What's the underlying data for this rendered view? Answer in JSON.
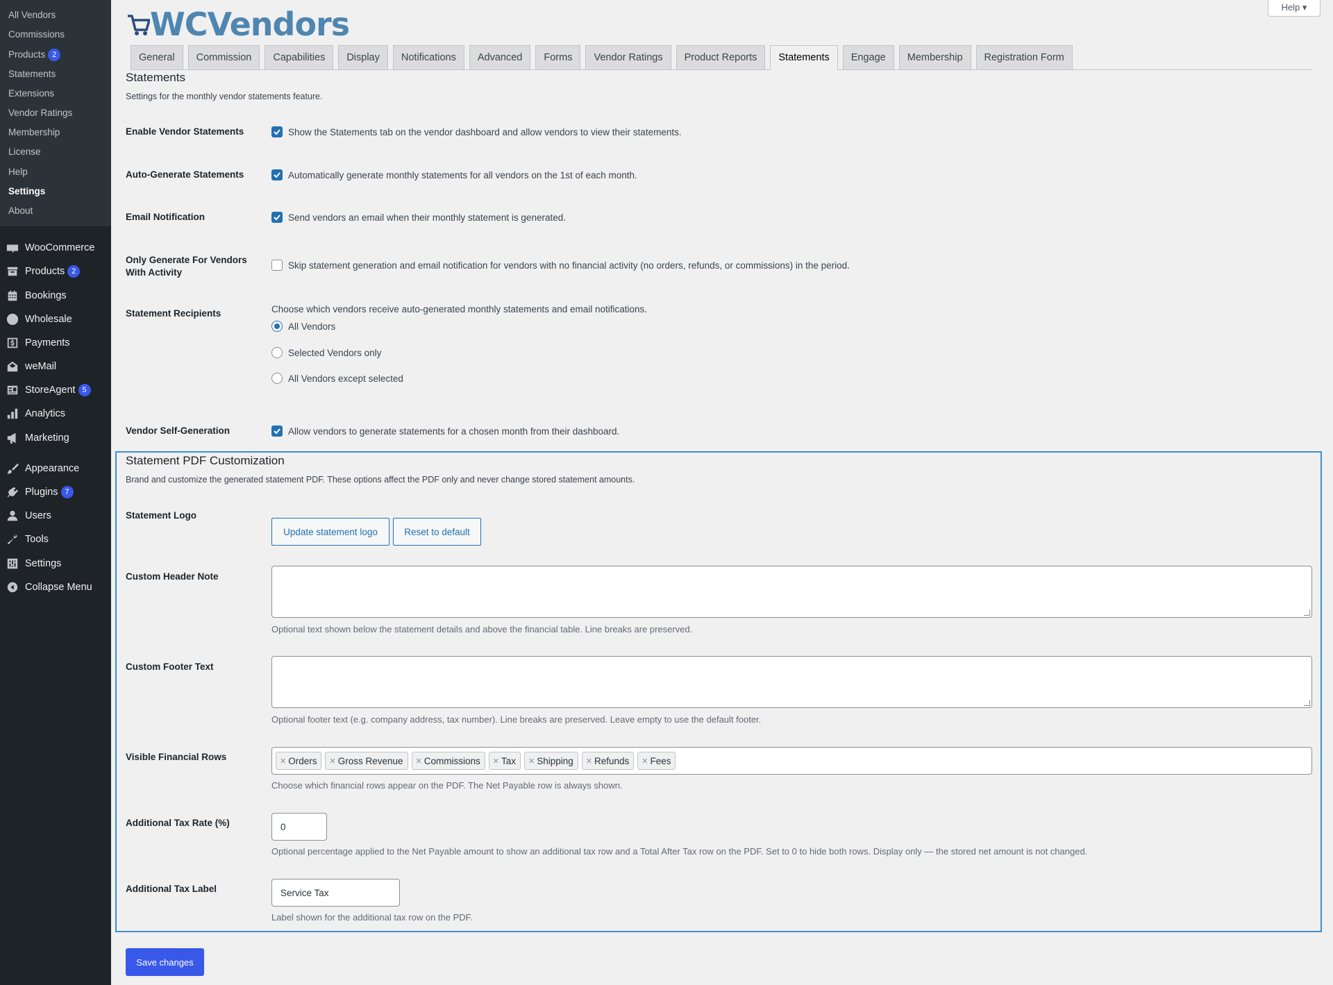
{
  "sidebar": {
    "sub_items": [
      {
        "label": "All Vendors",
        "badge": ""
      },
      {
        "label": "Commissions",
        "badge": ""
      },
      {
        "label": "Products",
        "badge": "2"
      },
      {
        "label": "Statements",
        "badge": ""
      },
      {
        "label": "Extensions",
        "badge": ""
      },
      {
        "label": "Vendor Ratings",
        "badge": ""
      },
      {
        "label": "Membership",
        "badge": ""
      },
      {
        "label": "License",
        "badge": ""
      },
      {
        "label": "Help",
        "badge": ""
      },
      {
        "label": "Settings",
        "badge": ""
      },
      {
        "label": "About",
        "badge": ""
      }
    ],
    "menu_items": [
      {
        "label": "WooCommerce",
        "icon": "woocommerce-icon",
        "badge": ""
      },
      {
        "label": "Products",
        "icon": "archive-icon",
        "badge": "2"
      },
      {
        "label": "Bookings",
        "icon": "calendar-icon",
        "badge": ""
      },
      {
        "label": "Wholesale",
        "icon": "wholesale-icon",
        "badge": ""
      },
      {
        "label": "Payments",
        "icon": "dollar-icon",
        "badge": ""
      },
      {
        "label": "weMail",
        "icon": "mail-icon",
        "badge": ""
      },
      {
        "label": "StoreAgent",
        "icon": "list-icon",
        "badge": "5"
      },
      {
        "label": "Analytics",
        "icon": "chart-bar-icon",
        "badge": ""
      },
      {
        "label": "Marketing",
        "icon": "megaphone-icon",
        "badge": ""
      },
      {
        "label": "Appearance",
        "icon": "paintbrush-icon",
        "badge": ""
      },
      {
        "label": "Plugins",
        "icon": "plugin-icon",
        "badge": "7"
      },
      {
        "label": "Users",
        "icon": "user-icon",
        "badge": ""
      },
      {
        "label": "Tools",
        "icon": "wrench-icon",
        "badge": ""
      },
      {
        "label": "Settings",
        "icon": "settings-icon",
        "badge": ""
      },
      {
        "label": "Collapse Menu",
        "icon": "collapse-icon",
        "badge": ""
      }
    ]
  },
  "header": {
    "logo_text": "WCVendors",
    "help_label": "Help ▾"
  },
  "tabs": [
    "General",
    "Commission",
    "Capabilities",
    "Display",
    "Notifications",
    "Advanced",
    "Forms",
    "Vendor Ratings",
    "Product Reports",
    "Statements",
    "Engage",
    "Membership",
    "Registration Form"
  ],
  "statements": {
    "title": "Statements",
    "description": "Settings for the monthly vendor statements feature.",
    "enable_label": "Enable Vendor Statements",
    "enable_text": "Show the Statements tab on the vendor dashboard and allow vendors to view their statements.",
    "auto_label": "Auto-Generate Statements",
    "auto_text": "Automatically generate monthly statements for all vendors on the 1st of each month.",
    "email_label": "Email Notification",
    "email_text": "Send vendors an email when their monthly statement is generated.",
    "activity_label": "Only Generate For Vendors With Activity",
    "activity_text": "Skip statement generation and email notification for vendors with no financial activity (no orders, refunds, or commissions) in the period.",
    "recipients_label": "Statement Recipients",
    "recipients_desc": "Choose which vendors receive auto-generated monthly statements and email notifications.",
    "recipients_options": [
      "All Vendors",
      "Selected Vendors only",
      "All Vendors except selected"
    ],
    "selfgen_label": "Vendor Self-Generation",
    "selfgen_text": "Allow vendors to generate statements for a chosen month from their dashboard."
  },
  "pdf": {
    "title": "Statement PDF Customization",
    "description": "Brand and customize the generated statement PDF. These options affect the PDF only and never change stored statement amounts.",
    "logo_label": "Statement Logo",
    "update_logo_button": "Update statement logo",
    "reset_button": "Reset to default",
    "header_note_label": "Custom Header Note",
    "header_note_help": "Optional text shown below the statement details and above the financial table. Line breaks are preserved.",
    "footer_label": "Custom Footer Text",
    "footer_help": "Optional footer text (e.g. company address, tax number). Line breaks are preserved. Leave empty to use the default footer.",
    "rows_label": "Visible Financial Rows",
    "rows": [
      "Orders",
      "Gross Revenue",
      "Commissions",
      "Tax",
      "Shipping",
      "Refunds",
      "Fees"
    ],
    "rows_help": "Choose which financial rows appear on the PDF. The Net Payable row is always shown.",
    "tax_rate_label": "Additional Tax Rate (%)",
    "tax_rate_value": "0",
    "tax_rate_help": "Optional percentage applied to the Net Payable amount to show an additional tax row and a Total After Tax row on the PDF. Set to 0 to hide both rows. Display only — the stored net amount is not changed.",
    "tax_label_label": "Additional Tax Label",
    "tax_label_value": "Service Tax",
    "tax_label_help": "Label shown for the additional tax row on the PDF."
  },
  "save_button": "Save changes",
  "colors": {
    "accent": "#3858e9",
    "sidebar": "#1d2327",
    "highlight_border": "#3e8ed0"
  }
}
